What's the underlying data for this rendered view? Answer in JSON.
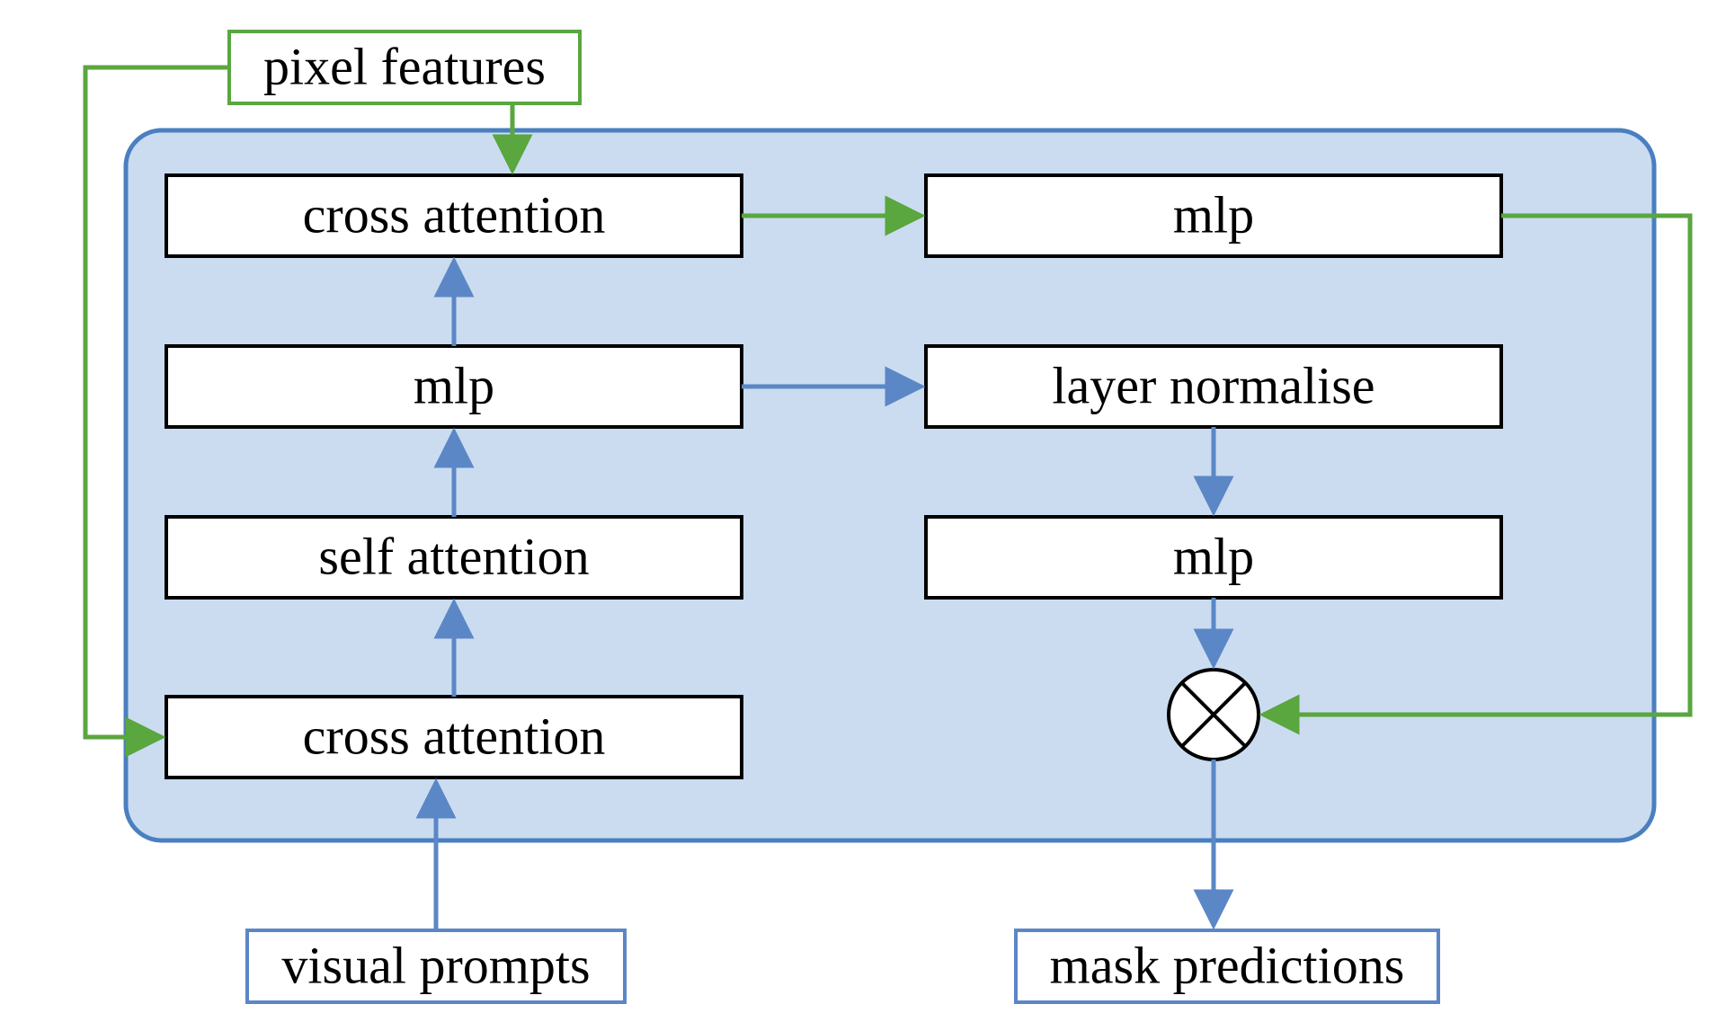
{
  "diagram": {
    "inputs": {
      "pixel_features": "pixel features",
      "visual_prompts": "visual prompts"
    },
    "blocks": {
      "cross_attention_top": "cross attention",
      "mlp_top_right": "mlp",
      "mlp_left": "mlp",
      "layer_normalise": "layer normalise",
      "self_attention": "self attention",
      "mlp_right": "mlp",
      "cross_attention_bottom": "cross attention"
    },
    "output": {
      "mask_predictions": "mask predictions"
    },
    "operator": {
      "name": "multiply"
    },
    "flows": [
      {
        "from": "visual_prompts",
        "to": "cross_attention_bottom",
        "color": "blue"
      },
      {
        "from": "cross_attention_bottom",
        "to": "self_attention",
        "color": "blue"
      },
      {
        "from": "self_attention",
        "to": "mlp_left",
        "color": "blue"
      },
      {
        "from": "mlp_left",
        "to": "cross_attention_top",
        "color": "blue"
      },
      {
        "from": "mlp_left",
        "to": "layer_normalise",
        "color": "blue"
      },
      {
        "from": "layer_normalise",
        "to": "mlp_right",
        "color": "blue"
      },
      {
        "from": "mlp_right",
        "to": "multiply",
        "color": "blue"
      },
      {
        "from": "multiply",
        "to": "mask_predictions",
        "color": "blue"
      },
      {
        "from": "pixel_features",
        "to": "cross_attention_top",
        "color": "green"
      },
      {
        "from": "pixel_features",
        "to": "cross_attention_bottom",
        "color": "green"
      },
      {
        "from": "cross_attention_top",
        "to": "mlp_top_right",
        "color": "green"
      },
      {
        "from": "mlp_top_right",
        "to": "multiply",
        "color": "green"
      }
    ],
    "colors": {
      "container_fill": "#cbdcf0",
      "container_stroke": "#4a7fc0",
      "green_stroke": "#5aa63f",
      "blue_stroke": "#5b87c6",
      "box_fill": "#ffffff",
      "box_stroke": "#000000"
    }
  }
}
